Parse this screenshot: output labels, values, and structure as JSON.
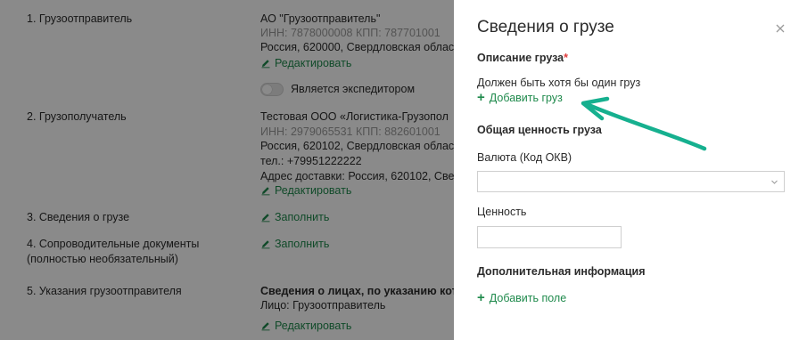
{
  "background_form": {
    "rows": [
      {
        "label": "1. Грузоотправитель"
      },
      {
        "label": "2. Грузополучатель"
      },
      {
        "label": "3. Сведения о грузе"
      },
      {
        "label": "4. Сопроводительные документы"
      },
      {
        "label_line2": "(полностью необязательный)"
      },
      {
        "label": "5. Указания грузоотправителя"
      }
    ],
    "shipper": {
      "name": "АО \"Грузоотправитель\"",
      "inn": "ИНН: 7878000008 КПП: 787701001",
      "address": "Россия, 620000, Свердловская област",
      "edit_label": "Редактировать",
      "forwarder_label": "Является экспедитором"
    },
    "consignee": {
      "name": "Тестовая ООО «Логистика-Грузопол",
      "inn": "ИНН: 2979065531 КПП: 882601001",
      "address": "Россия, 620102, Свердловская облас",
      "phone": "тел.: +79951222222",
      "delivery": "Адрес доставки: Россия, 620102, Све",
      "edit_label": "Редактировать"
    },
    "cargo_fill_label": "Заполнить",
    "docs_fill_label": "Заполнить",
    "instructions": {
      "heading": "Сведения о лицах, по указанию кот",
      "person": "Лицо: Грузоотправитель",
      "edit_label": "Редактировать"
    }
  },
  "drawer": {
    "title": "Сведения о грузе",
    "description_title": "Описание груза",
    "required_mark": "*",
    "hint": "Должен быть хотя бы один груз",
    "add_cargo_label": "Добавить груз",
    "total_value_title": "Общая ценность груза",
    "currency_label": "Валюта (Код ОКВ)",
    "currency_value": "",
    "value_label": "Ценность",
    "value_value": "",
    "extra_title": "Дополнительная информация",
    "add_field_label": "Добавить поле"
  },
  "icons": {
    "close": "close-icon",
    "pencil": "pencil-icon",
    "chevron": "chevron-down-icon",
    "plus": "plus-icon"
  },
  "colors": {
    "accent_green": "#1f8a4c",
    "annotation_arrow": "#16b08f",
    "required": "#e03b3b"
  }
}
